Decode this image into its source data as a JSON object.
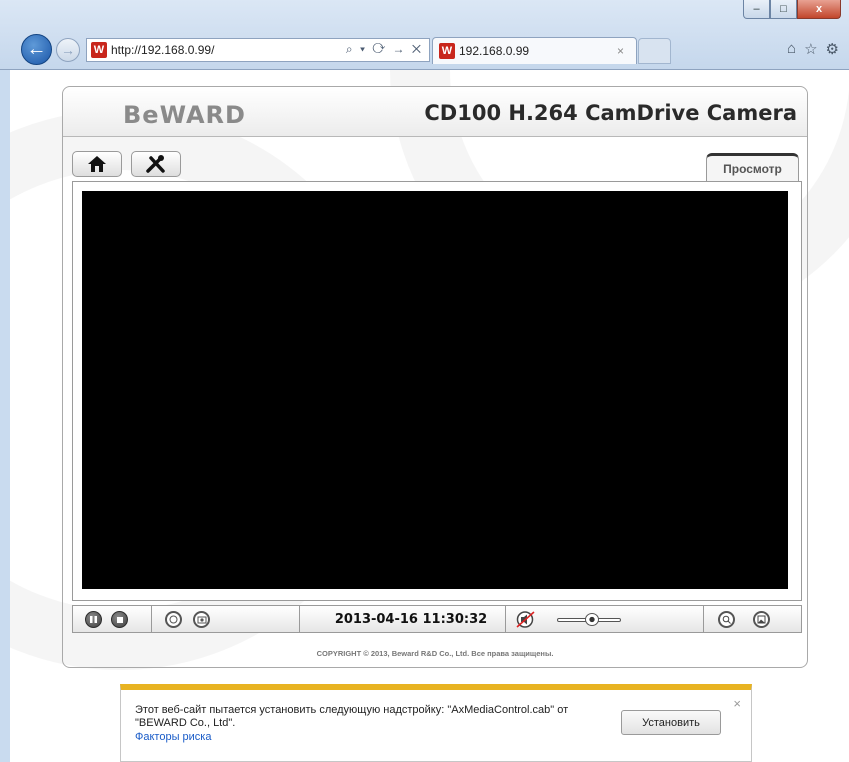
{
  "window": {
    "minimize_glyph": "–",
    "maximize_glyph": "□",
    "close_glyph": "x"
  },
  "browser": {
    "address": "http://192.168.0.99/",
    "address_tools": "⌕ ▾ ⟳ → ✕",
    "tab_title": "192.168.0.99",
    "tab_close": "×",
    "favicon_letter": "W",
    "toolbar_icons": [
      "home-icon",
      "favorites-star-icon",
      "settings-gear-icon"
    ]
  },
  "header": {
    "logo": "BeWARD",
    "model": "CD100 H.264 CamDrive Camera"
  },
  "nav": {
    "home_icon": "home-icon",
    "settings_icon": "tools-icon",
    "view_tab": "Просмотр"
  },
  "controls": {
    "datetime": "2013-04-16 11:30:32",
    "volume_level": 0.55
  },
  "footer": {
    "copyright": "COPYRIGHT © 2013, Beward R&D Co., Ltd. Все права защищены."
  },
  "notification": {
    "message": "Этот веб-сайт пытается установить следующую надстройку: \"AxMediaControl.cab\" от \"BEWARD Co., Ltd\".",
    "link": "Факторы риска",
    "install_button": "Установить",
    "close": "×"
  },
  "colors": {
    "notification_accent": "#e8b321",
    "video_background": "#000000",
    "link": "#1a5cc8"
  }
}
